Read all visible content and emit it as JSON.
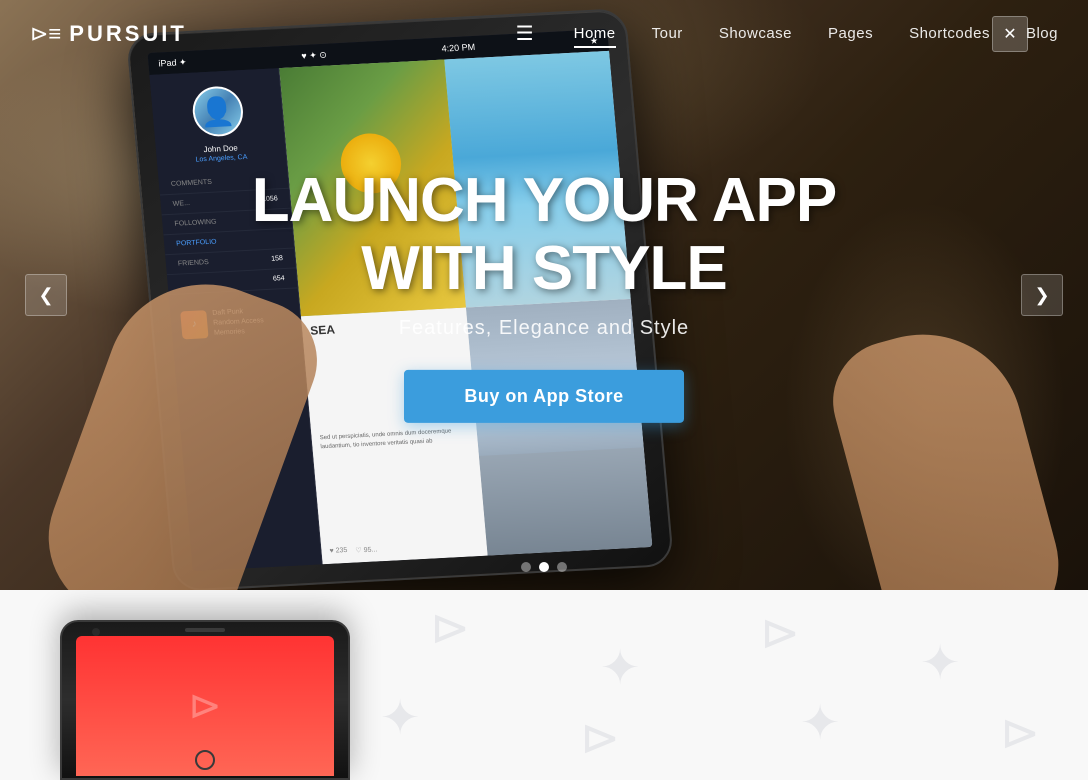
{
  "brand": {
    "name": "PURSUIT",
    "icon": "✈"
  },
  "nav": {
    "hamburger": "☰",
    "items": [
      {
        "label": "Home",
        "active": true
      },
      {
        "label": "Tour",
        "active": false
      },
      {
        "label": "Showcase",
        "active": false
      },
      {
        "label": "Pages",
        "active": false
      },
      {
        "label": "Shortcodes",
        "active": false
      },
      {
        "label": "Blog",
        "active": false
      }
    ]
  },
  "hero": {
    "title": "LAUNCH YOUR APP WITH STYLE",
    "subtitle": "Features, Elegance and Style",
    "cta_label": "Buy on App Store",
    "arrow_left": "❮",
    "arrow_right": "❯",
    "wrench": "✕",
    "dots": [
      {
        "active": false
      },
      {
        "active": true
      },
      {
        "active": false
      }
    ]
  },
  "ipad": {
    "status_time": "4:20 PM",
    "status_wifi": "iPad ✦",
    "profile_name": "John Doe",
    "profile_location": "Los Angeles, CA",
    "menu_items": [
      {
        "label": "COMMENTS",
        "value": ""
      },
      {
        "label": "WE...",
        "value": "1056"
      },
      {
        "label": "FOLLOWING",
        "value": ""
      },
      {
        "label": "PORTFOLIO",
        "value": ""
      },
      {
        "label": "FRIENDS",
        "value": "158"
      },
      {
        "label": "",
        "value": "654"
      }
    ],
    "music_artist": "Daft Punk",
    "music_album": "Random Access Memories",
    "sea_label": "SEA",
    "sea_text": "Sed ut perspiciatis, unde omnis dum doceremque laudantium, tio inventore veritatis quasi ab"
  },
  "below": {
    "background": "#f8f8f8"
  }
}
